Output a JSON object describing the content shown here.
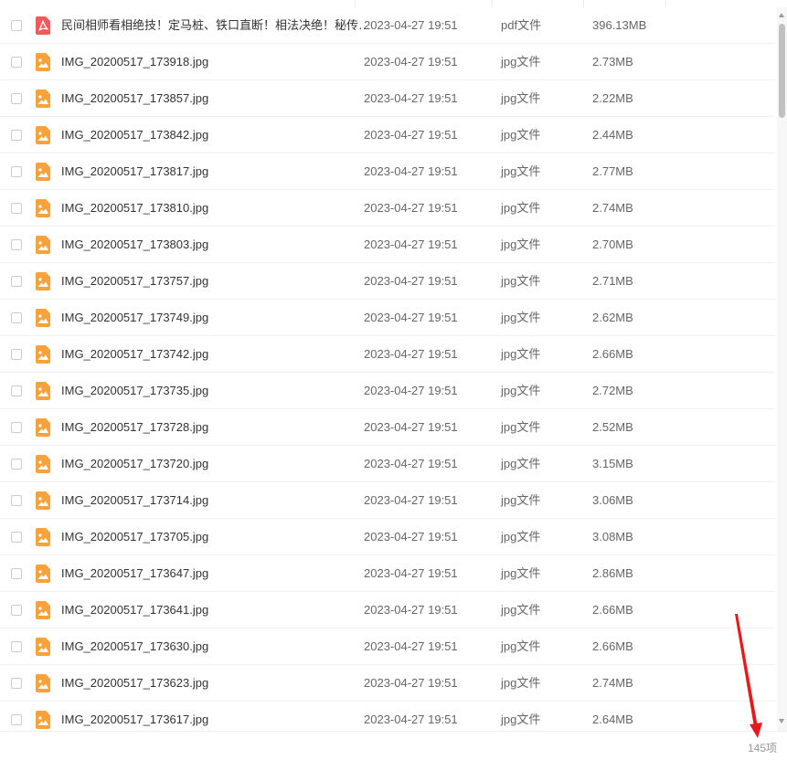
{
  "files": [
    {
      "name": "民间相师看相绝技！定马桩、铁口直断！相法决绝！秘传…",
      "date": "2023-04-27 19:51",
      "type": "pdf文件",
      "size": "396.13MB",
      "icon": "pdf-icon"
    },
    {
      "name": "IMG_20200517_173918.jpg",
      "date": "2023-04-27 19:51",
      "type": "jpg文件",
      "size": "2.73MB",
      "icon": "image-icon"
    },
    {
      "name": "IMG_20200517_173857.jpg",
      "date": "2023-04-27 19:51",
      "type": "jpg文件",
      "size": "2.22MB",
      "icon": "image-icon"
    },
    {
      "name": "IMG_20200517_173842.jpg",
      "date": "2023-04-27 19:51",
      "type": "jpg文件",
      "size": "2.44MB",
      "icon": "image-icon"
    },
    {
      "name": "IMG_20200517_173817.jpg",
      "date": "2023-04-27 19:51",
      "type": "jpg文件",
      "size": "2.77MB",
      "icon": "image-icon"
    },
    {
      "name": "IMG_20200517_173810.jpg",
      "date": "2023-04-27 19:51",
      "type": "jpg文件",
      "size": "2.74MB",
      "icon": "image-icon"
    },
    {
      "name": "IMG_20200517_173803.jpg",
      "date": "2023-04-27 19:51",
      "type": "jpg文件",
      "size": "2.70MB",
      "icon": "image-icon"
    },
    {
      "name": "IMG_20200517_173757.jpg",
      "date": "2023-04-27 19:51",
      "type": "jpg文件",
      "size": "2.71MB",
      "icon": "image-icon"
    },
    {
      "name": "IMG_20200517_173749.jpg",
      "date": "2023-04-27 19:51",
      "type": "jpg文件",
      "size": "2.62MB",
      "icon": "image-icon"
    },
    {
      "name": "IMG_20200517_173742.jpg",
      "date": "2023-04-27 19:51",
      "type": "jpg文件",
      "size": "2.66MB",
      "icon": "image-icon"
    },
    {
      "name": "IMG_20200517_173735.jpg",
      "date": "2023-04-27 19:51",
      "type": "jpg文件",
      "size": "2.72MB",
      "icon": "image-icon"
    },
    {
      "name": "IMG_20200517_173728.jpg",
      "date": "2023-04-27 19:51",
      "type": "jpg文件",
      "size": "2.52MB",
      "icon": "image-icon"
    },
    {
      "name": "IMG_20200517_173720.jpg",
      "date": "2023-04-27 19:51",
      "type": "jpg文件",
      "size": "3.15MB",
      "icon": "image-icon"
    },
    {
      "name": "IMG_20200517_173714.jpg",
      "date": "2023-04-27 19:51",
      "type": "jpg文件",
      "size": "3.06MB",
      "icon": "image-icon"
    },
    {
      "name": "IMG_20200517_173705.jpg",
      "date": "2023-04-27 19:51",
      "type": "jpg文件",
      "size": "3.08MB",
      "icon": "image-icon"
    },
    {
      "name": "IMG_20200517_173647.jpg",
      "date": "2023-04-27 19:51",
      "type": "jpg文件",
      "size": "2.86MB",
      "icon": "image-icon"
    },
    {
      "name": "IMG_20200517_173641.jpg",
      "date": "2023-04-27 19:51",
      "type": "jpg文件",
      "size": "2.66MB",
      "icon": "image-icon"
    },
    {
      "name": "IMG_20200517_173630.jpg",
      "date": "2023-04-27 19:51",
      "type": "jpg文件",
      "size": "2.66MB",
      "icon": "image-icon"
    },
    {
      "name": "IMG_20200517_173623.jpg",
      "date": "2023-04-27 19:51",
      "type": "jpg文件",
      "size": "2.74MB",
      "icon": "image-icon"
    },
    {
      "name": "IMG_20200517_173617.jpg",
      "date": "2023-04-27 19:51",
      "type": "jpg文件",
      "size": "2.64MB",
      "icon": "image-icon"
    }
  ],
  "footer": {
    "count": "145项"
  },
  "colors": {
    "pdf": "#f05a5a",
    "image": "#f7a23a",
    "annotation_arrow": "#e8191b"
  }
}
